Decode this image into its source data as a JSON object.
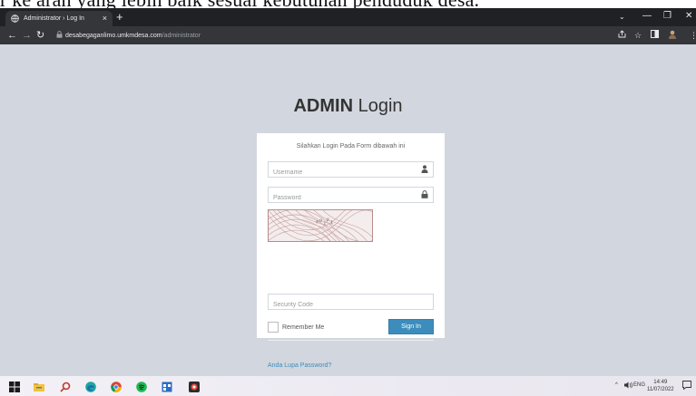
{
  "document": {
    "top_text": "r ke arah yang lebih baik sesuai kebutuhan penduduk desa."
  },
  "browser": {
    "tab_title": "Administrator › Log In",
    "tab_close": "×",
    "new_tab": "+",
    "url_host": "desabegaganlimo.umkmdesa.com",
    "url_path": "/administrator",
    "window_controls": {
      "minimize": "—",
      "maximize": "❐",
      "close": "✕",
      "chevron": "⌄"
    }
  },
  "login": {
    "brand_bold": "ADMIN",
    "brand_light": " Login",
    "message": "Silahkan Login Pada Form dibawah ini",
    "username_placeholder": "Username",
    "password_placeholder": "Password",
    "captcha_text": "ᵉ⁰₁⁰₁",
    "security_placeholder": "Security Code",
    "remember_label": "Remember Me",
    "signin_label": "Sign In",
    "forgot_label": "Anda Lupa Password?"
  },
  "taskbar": {
    "tray_caret": "^",
    "tray_lang": "ENG",
    "clock_time": "14:49",
    "clock_date": "11/07/2022"
  },
  "colors": {
    "page_bg": "#d2d6de",
    "signin_bg": "#3c8dbc",
    "link": "#3c8dbc",
    "chrome_dark": "#202124",
    "chrome_toolbar": "#35363a"
  }
}
